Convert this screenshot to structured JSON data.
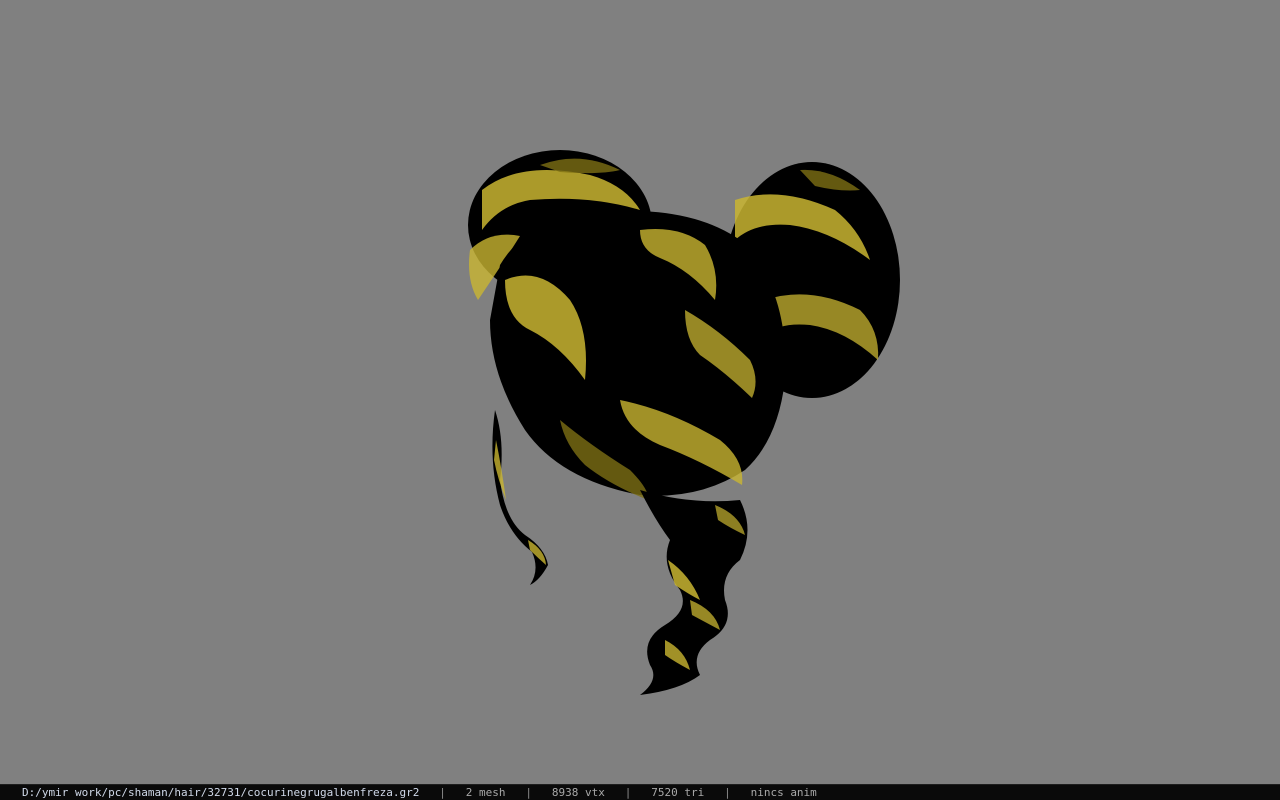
{
  "viewport": {
    "background_color": "#808080",
    "model": {
      "icon": "hair-model-icon",
      "colors": {
        "base": "#000000",
        "highlight": "#c9b531",
        "highlight_dark": "#7d6f14"
      }
    }
  },
  "status_bar": {
    "file_path": "D:/ymir work/pc/shaman/hair/32731/cocurinegrugalbenfreza.gr2",
    "separator": "|",
    "mesh": "2 mesh",
    "vertices": "8938 vtx",
    "triangles": "7520 tri",
    "animation": "nincs anim"
  }
}
